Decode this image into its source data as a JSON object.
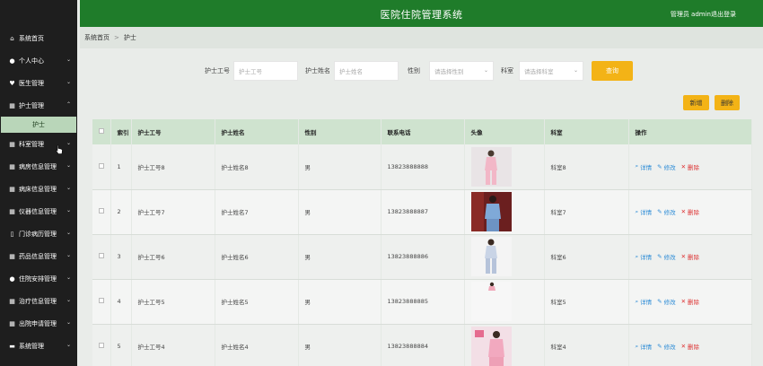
{
  "header": {
    "title": "医院住院管理系统",
    "user": "管理员 admin",
    "logout": "退出登录"
  },
  "sidebar": {
    "items": [
      {
        "label": "系统首页",
        "icon": "home-icon"
      },
      {
        "label": "个人中心",
        "icon": "user-icon"
      },
      {
        "label": "医生管理",
        "icon": "heart-icon"
      },
      {
        "label": "护士管理",
        "icon": "grid-icon"
      },
      {
        "label": "科室管理",
        "icon": "grid-icon"
      },
      {
        "label": "病房信息管理",
        "icon": "grid-icon"
      },
      {
        "label": "病床信息管理",
        "icon": "grid-icon"
      },
      {
        "label": "仪器信息管理",
        "icon": "grid-icon"
      },
      {
        "label": "门诊病历管理",
        "icon": "doc-icon"
      },
      {
        "label": "药品信息管理",
        "icon": "grid-icon"
      },
      {
        "label": "住院安排管理",
        "icon": "user-icon"
      },
      {
        "label": "治疗信息管理",
        "icon": "grid-icon"
      },
      {
        "label": "出院申请管理",
        "icon": "grid-icon"
      },
      {
        "label": "系统管理",
        "icon": "chat-icon"
      }
    ],
    "sub_item": "护士"
  },
  "breadcrumb": {
    "home": "系统首页",
    "sep": ">",
    "current": "护士"
  },
  "search": {
    "f1_label": "护士工号",
    "f1_placeholder": "护士工号",
    "f2_label": "护士姓名",
    "f2_placeholder": "护士姓名",
    "f3_label": "性别",
    "f3_placeholder": "请选择性别",
    "f4_label": "科室",
    "f4_placeholder": "请选择科室",
    "search_button": "查询"
  },
  "toolbar": {
    "add": "新增",
    "delete": "删除"
  },
  "table": {
    "headers": [
      "",
      "索引",
      "护士工号",
      "护士姓名",
      "性别",
      "联系电话",
      "头像",
      "科室",
      "操作"
    ],
    "rows": [
      {
        "idx": "1",
        "id": "护士工号8",
        "name": "护士姓名8",
        "sex": "男",
        "phone": "13823888888",
        "dept": "科室8"
      },
      {
        "idx": "2",
        "id": "护士工号7",
        "name": "护士姓名7",
        "sex": "男",
        "phone": "13823888887",
        "dept": "科室7"
      },
      {
        "idx": "3",
        "id": "护士工号6",
        "name": "护士姓名6",
        "sex": "男",
        "phone": "13823888886",
        "dept": "科室6"
      },
      {
        "idx": "4",
        "id": "护士工号5",
        "name": "护士姓名5",
        "sex": "男",
        "phone": "13823888885",
        "dept": "科室5"
      },
      {
        "idx": "5",
        "id": "护士工号4",
        "name": "护士姓名4",
        "sex": "男",
        "phone": "13823888884",
        "dept": "科室4"
      }
    ],
    "ops": {
      "detail": "详情",
      "edit": "修改",
      "delete": "删除"
    }
  },
  "colors": {
    "header_bg": "#1f7c2a",
    "sidebar_bg": "#1e1e1e",
    "accent": "#f3b316",
    "table_head": "#cfe3cf"
  }
}
